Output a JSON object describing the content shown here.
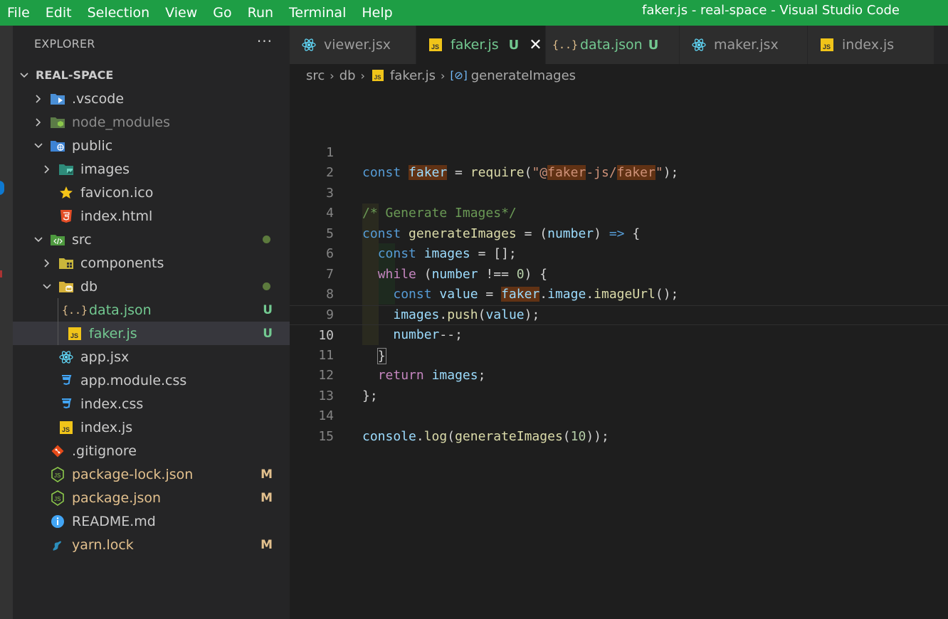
{
  "menu": [
    "File",
    "Edit",
    "Selection",
    "View",
    "Go",
    "Run",
    "Terminal",
    "Help"
  ],
  "window_title": "faker.js - real-space - Visual Studio Code",
  "explorer": {
    "header": "EXPLORER",
    "more": "···",
    "root": "REAL-SPACE",
    "items": [
      {
        "label": ".vscode",
        "icon": "vscode-folder-icon",
        "badge": "",
        "color": "#cccccc"
      },
      {
        "label": "node_modules",
        "icon": "node-folder-icon",
        "badge": "",
        "color": "#8b8b8b"
      },
      {
        "label": "public",
        "icon": "public-folder-icon",
        "badge": "",
        "color": "#cccccc"
      },
      {
        "label": "images",
        "icon": "images-folder-icon",
        "badge": "",
        "color": "#cccccc"
      },
      {
        "label": "favicon.ico",
        "icon": "star-icon",
        "badge": "",
        "color": "#cccccc"
      },
      {
        "label": "index.html",
        "icon": "html-icon",
        "badge": "",
        "color": "#cccccc"
      },
      {
        "label": "src",
        "icon": "src-folder-icon",
        "badge": "",
        "color": "#cccccc"
      },
      {
        "label": "components",
        "icon": "components-folder-icon",
        "badge": "",
        "color": "#cccccc"
      },
      {
        "label": "db",
        "icon": "db-folder-icon",
        "badge": "",
        "color": "#cccccc"
      },
      {
        "label": "data.json",
        "icon": "json-icon",
        "badge": "U",
        "color": "#73c991"
      },
      {
        "label": "faker.js",
        "icon": "js-icon",
        "badge": "U",
        "color": "#73c991"
      },
      {
        "label": "app.jsx",
        "icon": "react-icon",
        "badge": "",
        "color": "#cccccc"
      },
      {
        "label": "app.module.css",
        "icon": "css-icon",
        "badge": "",
        "color": "#cccccc"
      },
      {
        "label": "index.css",
        "icon": "css-icon",
        "badge": "",
        "color": "#cccccc"
      },
      {
        "label": "index.js",
        "icon": "js-icon",
        "badge": "",
        "color": "#cccccc"
      },
      {
        "label": ".gitignore",
        "icon": "git-icon",
        "badge": "",
        "color": "#cccccc"
      },
      {
        "label": "package-lock.json",
        "icon": "node-json-icon",
        "badge": "M",
        "color": "#e2c08d"
      },
      {
        "label": "package.json",
        "icon": "node-json-icon",
        "badge": "M",
        "color": "#e2c08d"
      },
      {
        "label": "README.md",
        "icon": "info-icon",
        "badge": "",
        "color": "#cccccc"
      },
      {
        "label": "yarn.lock",
        "icon": "yarn-icon",
        "badge": "M",
        "color": "#e2c08d"
      }
    ]
  },
  "tabs": [
    {
      "label": "viewer.jsx",
      "icon": "react-icon",
      "status": ""
    },
    {
      "label": "faker.js",
      "icon": "js-icon",
      "status": "U",
      "close": "✕"
    },
    {
      "label": "data.json",
      "icon": "json-icon",
      "status": "U"
    },
    {
      "label": "maker.jsx",
      "icon": "react-icon",
      "status": ""
    },
    {
      "label": "index.js",
      "icon": "js-icon",
      "status": ""
    }
  ],
  "breadcrumb": [
    "src",
    "db",
    "faker.js",
    "generateImages"
  ],
  "line_numbers": [
    "1",
    "2",
    "3",
    "4",
    "5",
    "6",
    "7",
    "8",
    "9",
    "10",
    "11",
    "12",
    "13",
    "14",
    "15"
  ],
  "code_tokens": {
    "l1": [
      "const",
      "faker",
      " = ",
      "require",
      "(",
      "\"",
      "@",
      "faker",
      "-js/",
      "faker",
      "\"",
      ");"
    ],
    "l3": [
      "/* Generate Images*/"
    ],
    "l4": [
      "const",
      "generateImages",
      " = (",
      "number",
      ") ",
      "=>",
      " {"
    ],
    "l5": [
      "const",
      "images",
      " = [];"
    ],
    "l6": [
      "while",
      " (",
      "number",
      " !== ",
      "0",
      ") {"
    ],
    "l7": [
      "const",
      "value",
      " = ",
      "faker",
      ".",
      "image",
      ".",
      "imageUrl",
      "();"
    ],
    "l8": [
      "images",
      ".",
      "push",
      "(",
      "value",
      ");"
    ],
    "l9": [
      "number",
      "--;"
    ],
    "l10": [
      "}"
    ],
    "l11": [
      "return",
      "images",
      ";"
    ],
    "l12": [
      "};"
    ],
    "l14": [
      "console",
      ".",
      "log",
      "(",
      "generateImages",
      "(",
      "10",
      "));"
    ]
  }
}
